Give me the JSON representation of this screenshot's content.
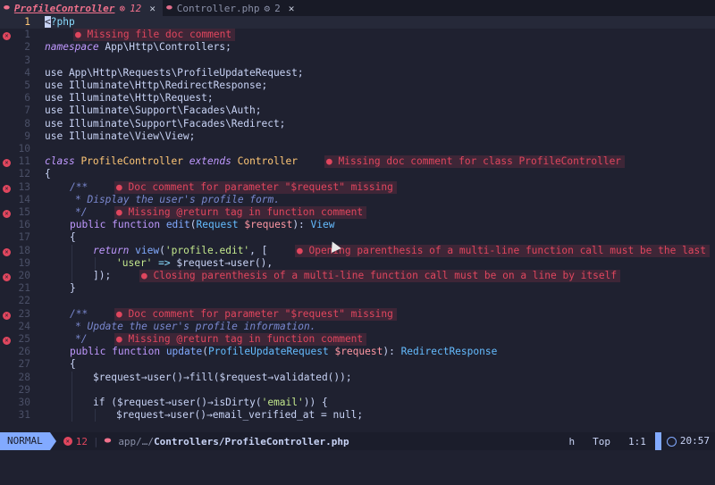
{
  "tabs": [
    {
      "name": "ProfileController",
      "diagnostic": "12",
      "close": "✕",
      "icon": "php-elephant-icon"
    },
    {
      "name": "Controller.php",
      "diagnostic": "2",
      "close": "✕",
      "icon": "php-elephant-icon"
    }
  ],
  "editor": {
    "current_line": 1,
    "lines": [
      {
        "n": "1",
        "err": false,
        "html_key": "l1"
      },
      {
        "n": "1",
        "err": true
      },
      {
        "n": "2",
        "err": false
      }
    ],
    "code": {
      "l1a": "<",
      "l1b": "?php",
      "l_ns_kw": "namespace",
      "l_ns": " App\\Http\\Controllers;",
      "use1": "use App\\Http\\Requests\\ProfileUpdateRequest;",
      "use2": "use Illuminate\\Http\\RedirectResponse;",
      "use3": "use Illuminate\\Http\\Request;",
      "use4": "use Illuminate\\Support\\Facades\\Auth;",
      "use5": "use Illuminate\\Support\\Facades\\Redirect;",
      "use6": "use Illuminate\\View\\View;",
      "class_kw": "class",
      "class_name": "ProfileController",
      "extends_kw": "extends",
      "parent": "Controller",
      "brace_open": "{",
      "brace_close": "}",
      "doc_open": "/**",
      "doc_display": "* Display the user's profile form.",
      "doc_close": "*/",
      "public": "public",
      "function": "function",
      "edit_fn": "edit",
      "edit_params_open": "(",
      "Request": "Request",
      "request_var": "$request",
      "edit_params_close": "): ",
      "View": "View",
      "return_kw": "return",
      "view_fn": "view",
      "view_args": "(",
      "profile_edit": "'profile.edit'",
      "view_after": ", [",
      "user_key": "'user'",
      "arrow": " => ",
      "user_expr": "$request→user(),",
      "array_close": "]);",
      "doc_update": "* Update the user's profile information.",
      "update_fn": "update",
      "ProfileUpdateRequest": "ProfileUpdateRequest",
      "RedirectResponse": "RedirectResponse",
      "fill_line": "$request→user()→fill($request→validated());",
      "if_line_a": "if ($request→user()→isDirty(",
      "email_str": "'email'",
      "if_line_b": ")) {",
      "null_line": "$request→user()→email_verified_at = null;"
    },
    "diagnostics": {
      "file_doc": "● Missing file doc comment",
      "class_doc": "● Missing doc comment for class ProfileController",
      "param_doc_1": "● Doc comment for parameter \"$request\" missing",
      "return_tag_1": "● Missing @return tag in function comment",
      "open_paren": "● Opening parenthesis of a multi-line function call must be the last",
      "close_paren": "● Closing parenthesis of a multi-line function call must be on a line by itself",
      "param_doc_2": "● Doc comment for parameter \"$request\" missing",
      "return_tag_2": "● Missing @return tag in function comment"
    },
    "line_numbers": [
      "1",
      "1",
      "2",
      "3",
      "4",
      "5",
      "6",
      "7",
      "8",
      "9",
      "10",
      "11",
      "12",
      "13",
      "14",
      "15",
      "16",
      "17",
      "18",
      "19",
      "20",
      "21",
      "22",
      "23",
      "24",
      "25",
      "26",
      "27",
      "28",
      "29",
      "30",
      "31"
    ]
  },
  "statusbar": {
    "mode": "NORMAL",
    "error_count": "12",
    "path_prefix": "app/…/",
    "path_file": "Controllers/ProfileController.php",
    "pending_key": "h",
    "scroll": "Top",
    "position": "1:1",
    "time": "20:57"
  },
  "colors": {
    "accent": "#82aaff",
    "error": "#e0465e",
    "background": "#1f2130"
  }
}
